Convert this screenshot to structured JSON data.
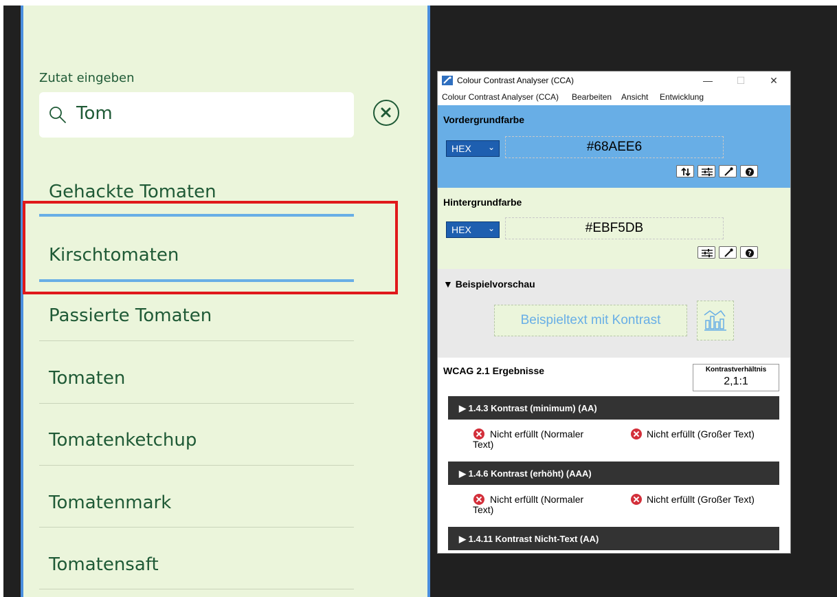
{
  "recipe_app": {
    "ingredient_label": "Zutat eingeben",
    "search": {
      "value": "Tom"
    },
    "suggestions": [
      "Gehackte Tomaten",
      "Kirschtomaten",
      "Passierte Tomaten",
      "Tomaten",
      "Tomatenketchup",
      "Tomatenmark",
      "Tomatensaft"
    ],
    "colors": {
      "background": "#EBF5DB",
      "text": "#1F5A36",
      "focus_line": "#68AEE6",
      "highlight_border": "#E0191B"
    },
    "icons": {
      "search": "search-icon",
      "clear": "clear-circle-x-icon"
    }
  },
  "cca": {
    "window_title": "Colour Contrast Analyser (CCA)",
    "window_buttons": {
      "minimize": "—",
      "maximize": "☐",
      "close": "✕"
    },
    "menu": [
      "Colour Contrast Analyser (CCA)",
      "Bearbeiten",
      "Ansicht",
      "Entwicklung"
    ],
    "foreground": {
      "title": "Vordergrundfarbe",
      "format": "HEX",
      "value": "#68AEE6",
      "tools": [
        "swap-icon",
        "sliders-icon",
        "eyedropper-icon",
        "help-icon"
      ]
    },
    "background": {
      "title": "Hintergrundfarbe",
      "format": "HEX",
      "value": "#EBF5DB",
      "tools": [
        "sliders-icon",
        "eyedropper-icon",
        "help-icon"
      ]
    },
    "preview": {
      "title": "▼ Beispielvorschau",
      "sample_text": "Beispieltext mit Kontrast",
      "icon": "chart-icon"
    },
    "results": {
      "title": "WCAG 2.1 Ergebnisse",
      "ratio_label": "Kontrastverhältnis",
      "ratio_value": "2,1:1",
      "criteria": [
        {
          "label": "▶  1.4.3 Kontrast (minimum) (AA)",
          "normal": "Nicht erfüllt (Normaler Text)",
          "large": "Nicht erfüllt (Großer Text)"
        },
        {
          "label": "▶  1.4.6 Kontrast (erhöht) (AAA)",
          "normal": "Nicht erfüllt (Normaler Text)",
          "large": "Nicht erfüllt (Großer Text)"
        },
        {
          "label": "▶  1.4.11 Kontrast Nicht-Text (AA)"
        }
      ]
    }
  }
}
